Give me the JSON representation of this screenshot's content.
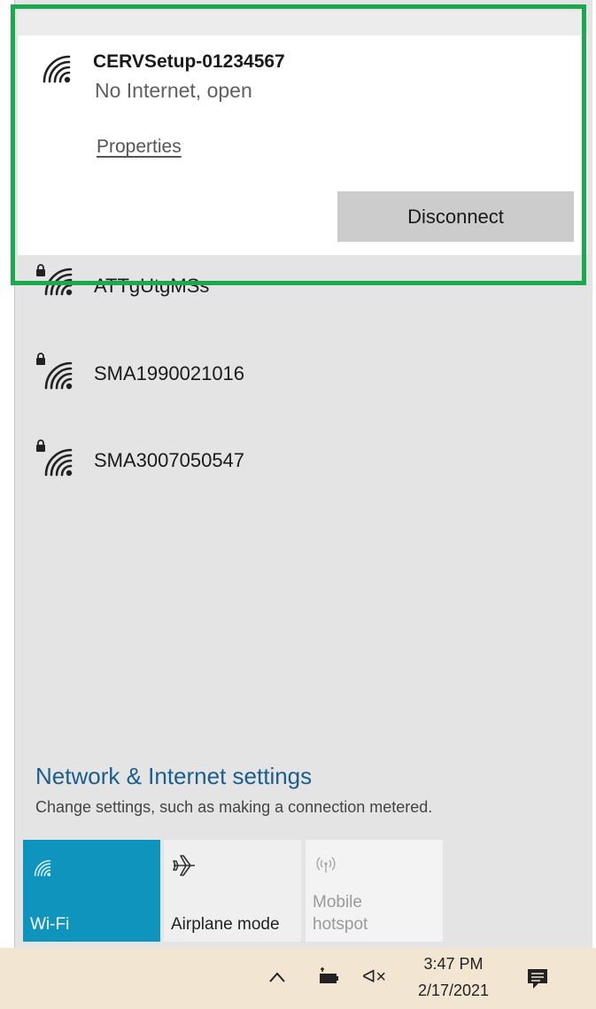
{
  "connected_network": {
    "ssid": "CERVSetup-01234567",
    "status": "No Internet, open",
    "properties_link": "Properties",
    "disconnect_label": "Disconnect"
  },
  "networks": [
    {
      "ssid": "ATTgUtgMSs",
      "secured": true
    },
    {
      "ssid": "SMA1990021016",
      "secured": true
    },
    {
      "ssid": "SMA3007050547",
      "secured": true
    }
  ],
  "settings": {
    "title": "Network & Internet settings",
    "subtitle": "Change settings, such as making a connection metered."
  },
  "quick_actions": [
    {
      "label": "Wi-Fi",
      "icon": "wifi-icon",
      "active": true
    },
    {
      "label": "Airplane mode",
      "icon": "airplane-icon",
      "active": false
    },
    {
      "label_line1": "Mobile",
      "label_line2": "hotspot",
      "icon": "hotspot-icon",
      "active": false,
      "disabled": true
    }
  ],
  "taskbar": {
    "time": "3:47 PM",
    "date": "2/17/2021",
    "volume_muted_glyph": "ᐊ×"
  },
  "colors": {
    "highlight": "#1aa94d",
    "wifi_tile": "#0f95bd",
    "settings_link": "#1a5e8c"
  }
}
